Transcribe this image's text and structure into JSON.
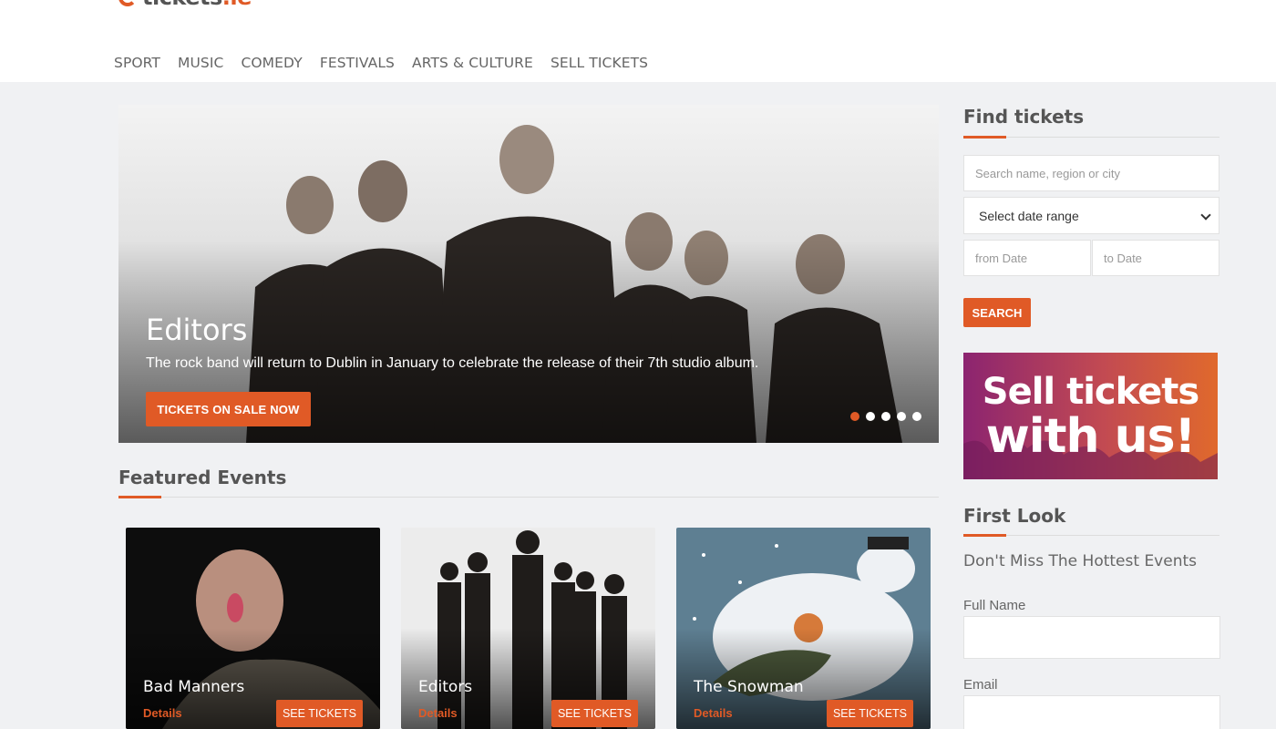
{
  "logo": {
    "text": "tickets",
    "tld": ".ie"
  },
  "nav": [
    "SPORT",
    "MUSIC",
    "COMEDY",
    "FESTIVALS",
    "ARTS & CULTURE",
    "SELL TICKETS"
  ],
  "hero": {
    "title": "Editors",
    "subtitle": "The rock band will return to Dublin in January to celebrate the release of their 7th studio album.",
    "button": "TICKETS ON SALE NOW",
    "slide_count": 5,
    "active_slide": 1
  },
  "featured": {
    "title": "Featured Events",
    "cards": [
      {
        "title": "Bad Manners",
        "details": "Details",
        "button": "SEE TICKETS"
      },
      {
        "title": "Editors",
        "details": "Details",
        "button": "SEE TICKETS"
      },
      {
        "title": "The Snowman",
        "details": "Details",
        "button": "SEE TICKETS"
      }
    ]
  },
  "find": {
    "title": "Find tickets",
    "search_placeholder": "Search name, region or city",
    "date_range": "Select date range",
    "from_placeholder": "from Date",
    "to_placeholder": "to Date",
    "search_button": "SEARCH"
  },
  "promo": {
    "line1": "Sell tickets",
    "line2": "with us!"
  },
  "first_look": {
    "title": "First Look",
    "subtitle": "Don't Miss The Hottest Events",
    "name_label": "Full Name",
    "email_label": "Email"
  },
  "colors": {
    "accent": "#e05a26",
    "background": "#f0f1f3",
    "promo_purple": "#9c2a6e"
  }
}
